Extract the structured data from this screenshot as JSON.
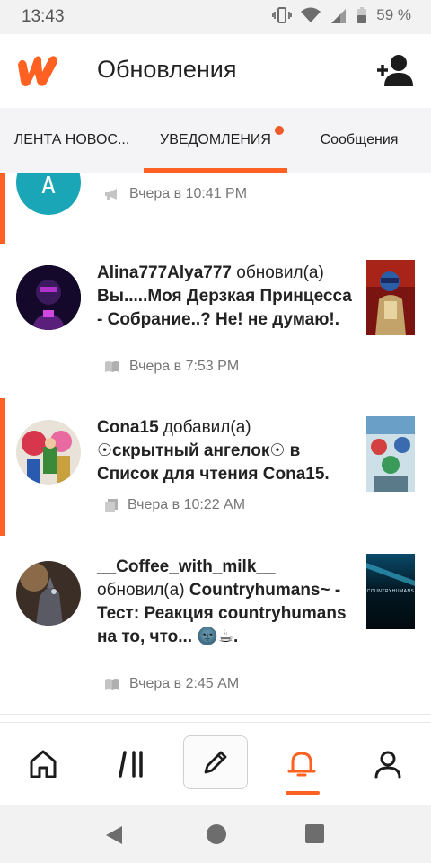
{
  "status_bar": {
    "time": "13:43",
    "battery": "59 %"
  },
  "header": {
    "title": "Обновления"
  },
  "tabs": [
    {
      "label": "ЛЕНТА НОВОС..."
    },
    {
      "label": "УВЕДОМЛЕНИЯ"
    },
    {
      "label": "Сообщения"
    }
  ],
  "notifications": [
    {
      "avatar_letter": "A",
      "time": "Вчера в 10:41 PM",
      "meta_icon": "megaphone-icon",
      "unread": true
    },
    {
      "user": "Alina777Alya777",
      "action": "обновил(а)",
      "content": "Вы.....Моя Дерзкая Принцесса - Собрание..? Не! не думаю!.",
      "time": "Вчера в 7:53 PM",
      "meta_icon": "book-icon",
      "unread": false
    },
    {
      "user": "Cona15",
      "action": "добавил(а)",
      "content": "☉скрытный ангелок☉ в Список для чтения Cona15.",
      "time": "Вчера в 10:22 AM",
      "meta_icon": "reading-list-icon",
      "unread": true
    },
    {
      "user": "__Coffee_with_milk__",
      "action": "обновил(а)",
      "content": "Countryhumans~ - Тест: Реакция countryhumans на то, что... 🌚☕.",
      "time": "Вчера в 2:45 AM",
      "meta_icon": "book-icon",
      "unread": false,
      "cover_label": "COUNTRYHUMANS"
    }
  ],
  "colors": {
    "accent": "#ff6122",
    "tab_bg": "#f4f3f5"
  }
}
